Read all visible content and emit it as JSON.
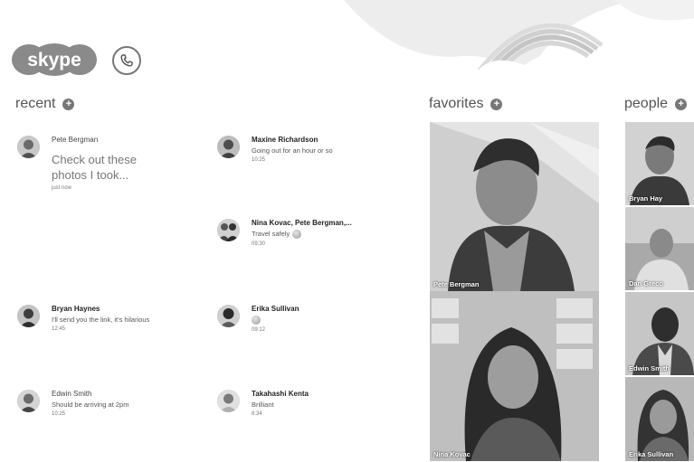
{
  "app": {
    "logo_text": "skype"
  },
  "header": {
    "call_icon": "phone-icon"
  },
  "recent": {
    "title": "recent",
    "items": [
      {
        "name": "Pete Bergman",
        "text": "Check out these photos I took...",
        "time": "just now"
      },
      {
        "name": "Maxine Richardson",
        "text": "Going out for an hour or so",
        "time": "10:25"
      },
      {
        "name": "Nina Kovac, Pete Bergman,...",
        "text": "Travel safely",
        "time": "09:30"
      },
      {
        "name": "Bryan Haynes",
        "text": "I'll send you the link, it's hilarious",
        "time": "12:45"
      },
      {
        "name": "Erika Sullivan",
        "text": "",
        "time": "09:12"
      },
      {
        "name": "Edwin Smith",
        "text": "Should be arriving at 2pm",
        "time": "10:25"
      },
      {
        "name": "Takahashi Kenta",
        "text": "Brilliant",
        "time": "8:34"
      }
    ]
  },
  "favorites": {
    "title": "favorites",
    "tiles": [
      {
        "name": "Pete Bergman"
      },
      {
        "name": "Nina Kovac"
      }
    ]
  },
  "people": {
    "title": "people",
    "tiles": [
      {
        "name": "Bryan Hay"
      },
      {
        "name": "Dan Greco"
      },
      {
        "name": "Edwin Smith"
      },
      {
        "name": "Erika Sullivan"
      }
    ]
  }
}
